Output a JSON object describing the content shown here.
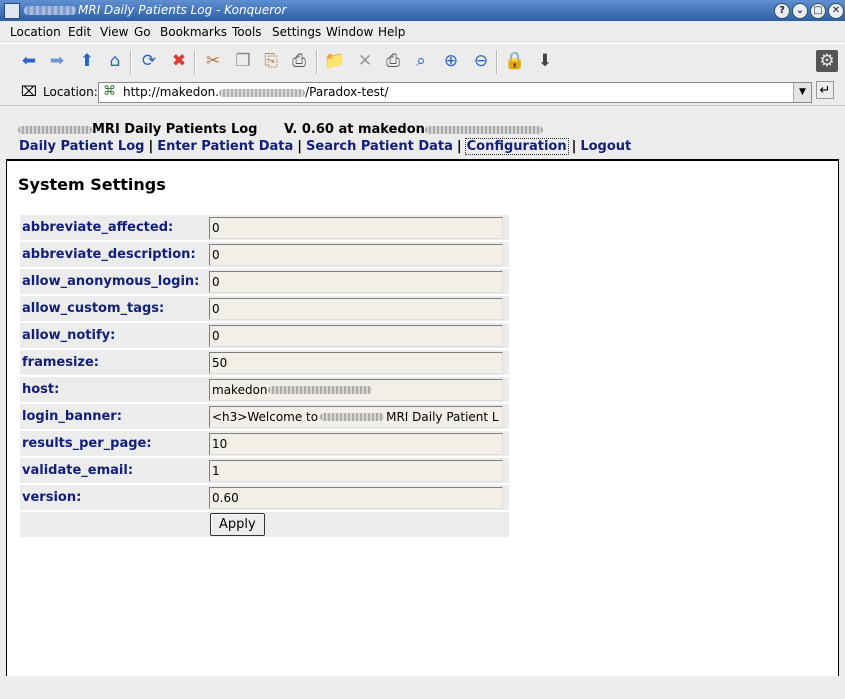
{
  "window": {
    "title_after": "MRI Daily Patients Log - Konqueror",
    "buttons": [
      "?",
      "⌄",
      "□",
      "✕"
    ]
  },
  "menu": [
    "Location",
    "Edit",
    "View",
    "Go",
    "Bookmarks",
    "Tools",
    "Settings",
    "Window",
    "Help"
  ],
  "toolbar_icons": [
    "back-icon",
    "forward-icon",
    "up-icon",
    "home-icon",
    "reload-icon",
    "stop-icon",
    "cut-icon",
    "copy-icon",
    "paste-icon",
    "print-icon",
    "new-folder-icon",
    "delete-icon",
    "print-preview-icon",
    "zoom-fit-icon",
    "zoom-in-icon",
    "zoom-out-icon",
    "security-lock-icon",
    "download-icon",
    "konqueror-gear-icon"
  ],
  "location": {
    "label": "Location:",
    "url_start": "http://makedon.",
    "url_end": "/Paradox-test/"
  },
  "header": {
    "brand_suffix": "MRI Daily Patients Log",
    "version_text": "V. 0.60 at makedon"
  },
  "nav": {
    "daily": "Daily Patient Log",
    "enter": "Enter Patient Data",
    "search": "Search Patient Data",
    "config": "Configuration",
    "logout": "Logout",
    "separator": "|"
  },
  "page": {
    "title": "System Settings",
    "apply_label": "Apply"
  },
  "settings": [
    {
      "key": "abbreviate_affected:",
      "value": "0"
    },
    {
      "key": "abbreviate_description:",
      "value": "0"
    },
    {
      "key": "allow_anonymous_login:",
      "value": "0"
    },
    {
      "key": "allow_custom_tags:",
      "value": "0"
    },
    {
      "key": "allow_notify:",
      "value": "0"
    },
    {
      "key": "framesize:",
      "value": "50"
    },
    {
      "key": "host:",
      "value": "makedon"
    },
    {
      "key": "login_banner:",
      "value": "<h3>Welcome to",
      "value_suffix": "MRI Daily Patient L"
    },
    {
      "key": "results_per_page:",
      "value": "10"
    },
    {
      "key": "validate_email:",
      "value": "1"
    },
    {
      "key": "version:",
      "value": "0.60"
    }
  ]
}
